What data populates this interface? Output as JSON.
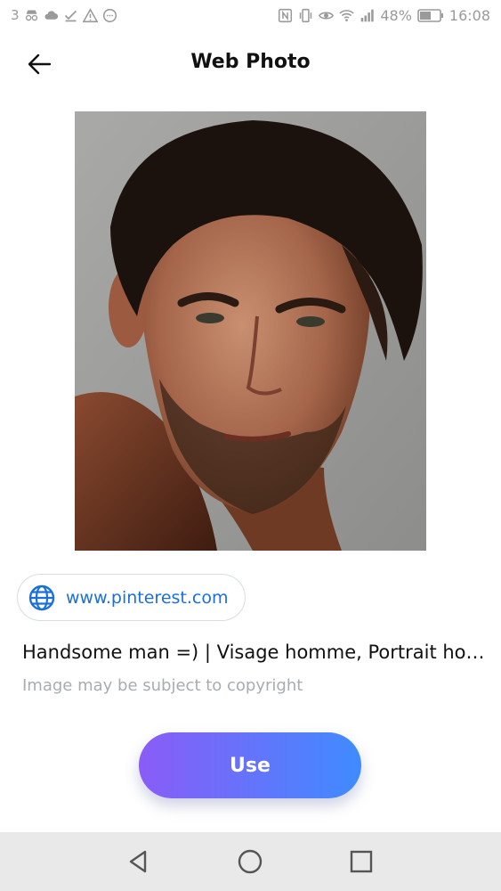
{
  "status_bar": {
    "left_number": "3",
    "battery": "48%",
    "time": "16:08",
    "icons_left": [
      "incognito-icon",
      "cloud-icon",
      "check-icon",
      "warning-icon",
      "chat-icon"
    ],
    "icons_right": [
      "nfc-icon",
      "vibrate-icon",
      "eye-icon",
      "wifi-icon",
      "signal-icon",
      "battery-icon"
    ]
  },
  "header": {
    "title": "Web Photo",
    "back_icon": "arrow-left-icon"
  },
  "photo": {
    "subject": "portrait-photo"
  },
  "source": {
    "icon": "globe-icon",
    "url": "www.pinterest.com"
  },
  "caption": {
    "title": "Handsome man =) | Visage homme, Portrait ho…",
    "notice": "Image may be subject to copyright"
  },
  "actions": {
    "use_label": "Use"
  },
  "colors": {
    "accent_start": "#8a5cf7",
    "accent_end": "#3f8bff",
    "link": "#1b6fd9"
  },
  "nav_bar": {
    "buttons": [
      "back-triangle-icon",
      "home-circle-icon",
      "recents-square-icon"
    ]
  }
}
